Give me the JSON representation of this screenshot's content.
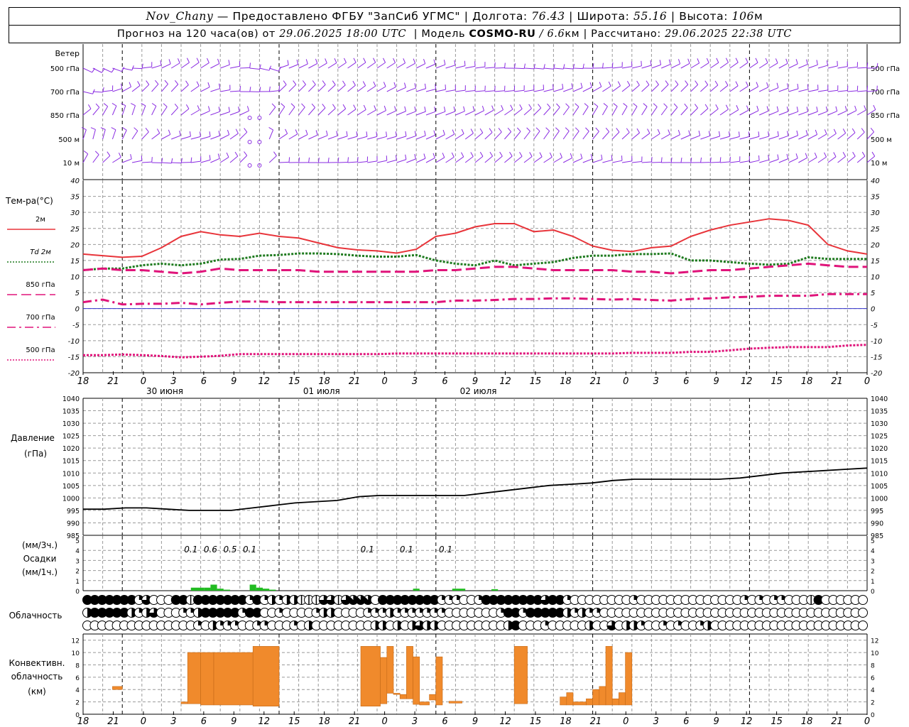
{
  "header": {
    "station": "Nov_Chany",
    "provider": "— Предоставлено ФГБУ \"ЗапСиб УГМС\"",
    "lon_label": "Долгота:",
    "lon": "76.43",
    "lat_label": "Широта:",
    "lat": "55.16",
    "alt_label": "Высота:",
    "alt": "106",
    "alt_unit": "м",
    "forecast_label": "Прогноз на 120 часа(ов) от",
    "forecast_time": "29.06.2025 18:00 UTC",
    "model_label": "Модель",
    "model": "COSMO-RU",
    "model_res": "6.6",
    "model_res_unit": "км",
    "calc_label": "Рассчитано:",
    "calc_time": "29.06.2025 22:38 UTC"
  },
  "labels": {
    "wind": "Ветер",
    "wind_levels": [
      "500 гПа",
      "700 гПа",
      "850 гПа",
      "500 м",
      "10  м"
    ],
    "temp_title": "Тем-ра(°С)",
    "temp_legend": [
      "2м",
      "Td  2м",
      "850 гПа",
      "700 гПа",
      "500 гПа"
    ],
    "pressure_title": [
      "Давление",
      "(гПа)"
    ],
    "precip_title": [
      "(мм/3ч.)",
      "Осадки",
      "(мм/1ч.)"
    ],
    "cloud_title": "Облачность",
    "conv_title": [
      "Конвективн.",
      "облачность",
      "(км)"
    ]
  },
  "time_axis": {
    "ticks": [
      "18",
      "21",
      "0",
      "3",
      "6",
      "9",
      "12",
      "15",
      "18",
      "21",
      "0",
      "3",
      "6",
      "9",
      "12",
      "15",
      "18",
      "21",
      "0",
      "3",
      "6",
      "9",
      "12",
      "15",
      "18",
      "21",
      "0"
    ],
    "days": [
      "30 июня",
      "01 июля",
      "02 июля"
    ]
  },
  "chart_data": [
    {
      "type": "line",
      "title": "Тем-ра(°С)",
      "x_hours": [
        0,
        3,
        6,
        9,
        12,
        15,
        18,
        21,
        24,
        27,
        30,
        33,
        36,
        39,
        42,
        45,
        48,
        51,
        54,
        57,
        60,
        63,
        66,
        69,
        72,
        75,
        78,
        81,
        84,
        87,
        90,
        93,
        96,
        99,
        102,
        105,
        108,
        111,
        114,
        117,
        120
      ],
      "ylim": [
        -20,
        40
      ],
      "yticks": [
        -20,
        -15,
        -10,
        -5,
        0,
        5,
        10,
        15,
        20,
        25,
        30,
        35,
        40
      ],
      "series": [
        {
          "name": "2м",
          "color": "#e8343a",
          "style": "solid",
          "values": [
            17,
            16.5,
            16,
            16.3,
            19,
            22.5,
            24,
            23,
            22.5,
            23.5,
            22.5,
            22,
            20.5,
            19,
            18.3,
            18,
            17.3,
            18.5,
            22.5,
            23.5,
            25.5,
            26.5,
            26.5,
            24,
            24.5,
            22.5,
            19.5,
            18.2,
            17.8,
            19,
            19.5,
            22.5,
            24.5,
            26,
            27,
            28,
            27.5,
            26,
            20,
            18,
            17
          ]
        },
        {
          "name": "Td  2м",
          "color": "#1e7a1e",
          "style": "dotted",
          "values": [
            12,
            12.5,
            12.5,
            13.5,
            14,
            13.5,
            14,
            15.3,
            15.5,
            16.5,
            16.7,
            17.2,
            17.2,
            17,
            16.5,
            16.2,
            16.2,
            16.7,
            15,
            14,
            13.5,
            15,
            13.5,
            14,
            14.5,
            15.8,
            16.5,
            16.5,
            17,
            17,
            17.2,
            15,
            15,
            14.5,
            14,
            13.7,
            14,
            16,
            15.5,
            15.5,
            15.5
          ]
        },
        {
          "name": "850 гПа",
          "color": "#e0137a",
          "style": "dash",
          "values": [
            12,
            12.5,
            12,
            12,
            11.5,
            11,
            11.5,
            12.5,
            12,
            12,
            12,
            12,
            11.5,
            11.5,
            11.5,
            11.5,
            11.5,
            11.5,
            12,
            12,
            12.5,
            13,
            13,
            12.5,
            12,
            12,
            12,
            12,
            11.5,
            11.5,
            11,
            11.5,
            12,
            12,
            12.5,
            13,
            13.5,
            14,
            13.5,
            13,
            13
          ]
        },
        {
          "name": "700 гПа",
          "color": "#e0137a",
          "style": "dashdot",
          "values": [
            2,
            2.8,
            1.3,
            1.5,
            1.5,
            1.8,
            1.3,
            1.8,
            2.2,
            2.2,
            2,
            2,
            2,
            2,
            2,
            2,
            2,
            2,
            2,
            2.5,
            2.5,
            2.7,
            3,
            3,
            3.2,
            3.2,
            3,
            2.8,
            3,
            2.7,
            2.5,
            3,
            3.2,
            3.5,
            3.7,
            4,
            4,
            4,
            4.5,
            4.5,
            4.5
          ]
        },
        {
          "name": "500 гПа",
          "color": "#e0137a",
          "style": "dotted",
          "values": [
            -14.5,
            -14.5,
            -14.3,
            -14.5,
            -14.8,
            -15.2,
            -15,
            -14.7,
            -14.2,
            -14.2,
            -14.2,
            -14.2,
            -14.2,
            -14.2,
            -14.2,
            -14.2,
            -14,
            -14,
            -14,
            -14,
            -14,
            -14,
            -14,
            -14,
            -14,
            -14,
            -14,
            -14,
            -13.8,
            -13.8,
            -13.8,
            -13.5,
            -13.5,
            -13,
            -12.5,
            -12.2,
            -12,
            -12,
            -12,
            -11.5,
            -11.3
          ]
        }
      ]
    },
    {
      "type": "line",
      "title": "Давление",
      "ylabel": "(гПа)",
      "x_hours": [
        0,
        6,
        12,
        18,
        24,
        30,
        36,
        42,
        48,
        54,
        60,
        66,
        72,
        78,
        84,
        90,
        96,
        102,
        108,
        114,
        120
      ],
      "ylim": [
        985,
        1040
      ],
      "yticks": [
        985,
        990,
        995,
        1000,
        1005,
        1010,
        1015,
        1020,
        1025,
        1030,
        1035,
        1040
      ],
      "series": [
        {
          "name": "",
          "color": "#000000",
          "values": [
            995.5,
            995.5,
            996,
            996,
            995.5,
            995,
            995,
            995,
            996,
            997,
            998,
            998.5,
            999,
            1000.5,
            1001,
            1001,
            1001,
            1001,
            1001,
            1002,
            1003,
            1004,
            1005,
            1005.5,
            1006,
            1007,
            1007.5,
            1007.5,
            1007.5,
            1007.5,
            1007.5,
            1008,
            1009,
            1010,
            1010.5,
            1011,
            1011.5,
            1012
          ]
        }
      ]
    },
    {
      "type": "bar",
      "title": "Осадки",
      "ylabel": "(мм/1ч.)",
      "ylim": [
        0,
        5
      ],
      "yticks": [
        0,
        1,
        2,
        3,
        4,
        5
      ],
      "hourly_bars": [
        {
          "hour": 17,
          "value": 0.3
        },
        {
          "hour": 18,
          "value": 0.3
        },
        {
          "hour": 19,
          "value": 0.3
        },
        {
          "hour": 20,
          "value": 0.6
        },
        {
          "hour": 21,
          "value": 0.2
        },
        {
          "hour": 22,
          "value": 0.1
        },
        {
          "hour": 26,
          "value": 0.6
        },
        {
          "hour": 27,
          "value": 0.3
        },
        {
          "hour": 28,
          "value": 0.2
        },
        {
          "hour": 29,
          "value": 0.1
        },
        {
          "hour": 51,
          "value": 0.2
        },
        {
          "hour": 57,
          "value": 0.2
        },
        {
          "hour": 58,
          "value": 0.2
        },
        {
          "hour": 63,
          "value": 0.15
        }
      ],
      "three_hour_labels": [
        {
          "hour": 16.5,
          "text": "0.1"
        },
        {
          "hour": 19.5,
          "text": "0.6"
        },
        {
          "hour": 22.5,
          "text": "0.5"
        },
        {
          "hour": 25.5,
          "text": "0.1"
        },
        {
          "hour": 43.5,
          "text": "0.1"
        },
        {
          "hour": 49.5,
          "text": "0.1"
        },
        {
          "hour": 55.5,
          "text": "0.1"
        }
      ]
    },
    {
      "type": "table",
      "title": "Облачность",
      "rows": [
        "high",
        "mid",
        "low"
      ],
      "cover_eighths": [
        [
          8,
          8,
          8,
          8,
          8,
          8,
          8,
          2,
          6,
          0,
          0,
          0,
          8,
          8,
          1,
          8,
          8,
          8,
          8,
          8,
          8,
          8,
          2,
          8,
          2,
          4,
          2,
          4,
          4,
          1,
          1,
          1,
          6,
          6,
          1,
          6,
          7,
          7,
          7,
          0,
          8,
          8,
          8,
          8,
          8,
          8,
          8,
          8,
          2,
          2,
          2,
          0,
          0,
          2,
          8,
          8,
          8,
          8,
          8,
          8,
          8,
          8,
          6,
          8,
          8,
          2,
          0,
          0,
          0,
          0,
          0,
          0,
          0,
          0,
          2,
          0,
          0,
          0,
          0,
          0,
          0,
          0,
          0,
          0,
          0,
          0,
          0,
          0,
          0,
          2,
          0,
          2,
          0,
          2,
          2,
          0,
          0,
          0,
          1,
          8,
          0,
          0,
          0,
          0,
          0,
          0
        ],
        [
          4,
          8,
          8,
          8,
          8,
          8,
          4,
          2,
          4,
          6,
          0,
          0,
          0,
          2,
          2,
          4,
          8,
          8,
          8,
          8,
          8,
          2,
          8,
          8,
          0,
          0,
          2,
          0,
          0,
          0,
          0,
          2,
          4,
          4,
          0,
          0,
          0,
          0,
          2,
          2,
          2,
          4,
          2,
          2,
          2,
          2,
          2,
          2,
          2,
          0,
          0,
          0,
          0,
          0,
          0,
          0,
          2,
          8,
          8,
          2,
          8,
          8,
          8,
          8,
          8,
          4,
          2,
          4,
          2,
          2,
          0,
          0,
          0,
          0,
          0,
          0,
          0,
          0,
          0,
          0,
          0,
          0,
          0,
          0,
          0,
          0,
          0,
          0,
          0,
          0,
          0,
          0,
          0,
          0,
          0,
          0,
          0,
          0,
          0,
          0,
          0,
          0,
          0,
          0,
          0,
          0
        ],
        [
          0,
          0,
          0,
          0,
          0,
          0,
          0,
          0,
          0,
          0,
          0,
          0,
          0,
          0,
          0,
          2,
          0,
          4,
          2,
          2,
          2,
          0,
          0,
          2,
          2,
          0,
          0,
          0,
          2,
          0,
          4,
          0,
          0,
          0,
          0,
          0,
          0,
          0,
          0,
          4,
          4,
          0,
          4,
          0,
          4,
          6,
          4,
          4,
          0,
          0,
          0,
          0,
          0,
          0,
          0,
          0,
          0,
          4,
          8,
          0,
          0,
          0,
          2,
          0,
          0,
          0,
          0,
          0,
          4,
          0,
          0,
          6,
          0,
          4,
          4,
          2,
          0,
          0,
          2,
          0,
          2,
          0,
          0,
          2,
          4,
          0,
          0,
          0,
          0,
          0,
          0,
          0,
          0,
          0,
          0,
          0,
          0,
          0,
          0,
          0,
          0,
          0,
          0,
          0,
          0,
          0
        ]
      ]
    },
    {
      "type": "bar",
      "title": "Конвективн. облачность",
      "ylabel": "(км)",
      "ylim": [
        0,
        13
      ],
      "yticks": [
        0,
        2,
        4,
        6,
        8,
        10,
        12
      ],
      "bars": [
        {
          "x0": 4.5,
          "x1": 6,
          "bottom": 4.0,
          "top": 4.5
        },
        {
          "x0": 15,
          "x1": 16,
          "bottom": 1.7,
          "top": 2.0
        },
        {
          "x0": 16,
          "x1": 18,
          "bottom": 1.7,
          "top": 10.0
        },
        {
          "x0": 18,
          "x1": 20,
          "bottom": 1.5,
          "top": 10.0
        },
        {
          "x0": 20,
          "x1": 26,
          "bottom": 1.5,
          "top": 10.0
        },
        {
          "x0": 26,
          "x1": 30,
          "bottom": 1.3,
          "top": 11.0
        },
        {
          "x0": 42.5,
          "x1": 45.5,
          "bottom": 1.3,
          "top": 11.0
        },
        {
          "x0": 45.5,
          "x1": 46.5,
          "bottom": 1.7,
          "top": 9.2
        },
        {
          "x0": 46.5,
          "x1": 47.5,
          "bottom": 3.4,
          "top": 11.0
        },
        {
          "x0": 47.5,
          "x1": 48.5,
          "bottom": 3.2,
          "top": 3.4
        },
        {
          "x0": 48.5,
          "x1": 49.5,
          "bottom": 2.5,
          "top": 3.2
        },
        {
          "x0": 49.5,
          "x1": 50.5,
          "bottom": 2.5,
          "top": 11.0
        },
        {
          "x0": 50.5,
          "x1": 51.5,
          "bottom": 1.6,
          "top": 9.3
        },
        {
          "x0": 51.5,
          "x1": 53,
          "bottom": 1.5,
          "top": 2.0
        },
        {
          "x0": 53,
          "x1": 54,
          "bottom": 2.3,
          "top": 3.2
        },
        {
          "x0": 54,
          "x1": 55,
          "bottom": 1.5,
          "top": 9.3
        },
        {
          "x0": 56,
          "x1": 58,
          "bottom": 1.8,
          "top": 2.1
        },
        {
          "x0": 66,
          "x1": 68,
          "bottom": 1.7,
          "top": 11.0
        },
        {
          "x0": 73,
          "x1": 74,
          "bottom": 1.5,
          "top": 2.8
        },
        {
          "x0": 74,
          "x1": 75,
          "bottom": 1.5,
          "top": 3.5
        },
        {
          "x0": 75,
          "x1": 77,
          "bottom": 1.5,
          "top": 2.0
        },
        {
          "x0": 77,
          "x1": 78,
          "bottom": 1.5,
          "top": 2.5
        },
        {
          "x0": 78,
          "x1": 79,
          "bottom": 1.5,
          "top": 4.0
        },
        {
          "x0": 79,
          "x1": 80,
          "bottom": 1.5,
          "top": 4.5
        },
        {
          "x0": 80,
          "x1": 81,
          "bottom": 1.5,
          "top": 11.0
        },
        {
          "x0": 81,
          "x1": 82,
          "bottom": 1.5,
          "top": 2.5
        },
        {
          "x0": 82,
          "x1": 83,
          "bottom": 1.5,
          "top": 3.5
        },
        {
          "x0": 83,
          "x1": 84,
          "bottom": 1.5,
          "top": 10.0
        }
      ]
    }
  ],
  "colors": {
    "wind": "#8a2be2",
    "precip": "#22bb22",
    "conv": "#f08a2c",
    "zero_line": "#3333cc",
    "grid": "#999999"
  }
}
